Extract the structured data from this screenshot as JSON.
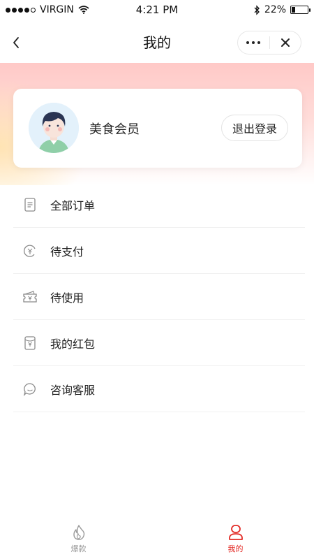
{
  "status_bar": {
    "carrier": "VIRGIN",
    "time": "4:21 PM",
    "battery": "22%",
    "battery_level": 0.22
  },
  "nav": {
    "title": "我的",
    "back_icon": "chevron-left-icon",
    "more_icon": "more-dots-icon",
    "close_icon": "close-icon"
  },
  "profile": {
    "username": "美食会员",
    "logout_label": "退出登录"
  },
  "menu": {
    "items": [
      {
        "label": "全部订单",
        "icon": "order-list-icon"
      },
      {
        "label": "待支付",
        "icon": "pending-payment-icon"
      },
      {
        "label": "待使用",
        "icon": "ticket-icon"
      },
      {
        "label": "我的红包",
        "icon": "red-envelope-icon"
      },
      {
        "label": "咨询客服",
        "icon": "chat-bubble-icon"
      }
    ]
  },
  "tab_bar": {
    "tabs": [
      {
        "label": "爆款",
        "icon": "flame-icon",
        "active": false
      },
      {
        "label": "我的",
        "icon": "profile-icon",
        "active": true
      }
    ]
  },
  "colors": {
    "accent": "#e32b26",
    "header_gradient_top": "#ffc9c7",
    "inactive_tab": "#9a9a9a"
  }
}
